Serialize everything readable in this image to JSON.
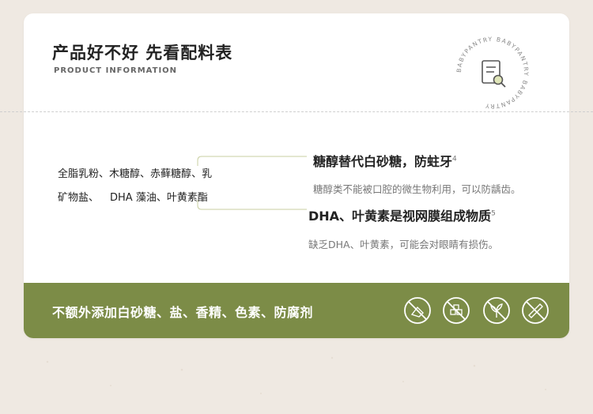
{
  "header": {
    "title": "产品好不好 先看配料表",
    "subtitle": "PRODUCT INFORMATION",
    "badge_text": "BABYPANTRY BABYPANTRY BABYPANTRY"
  },
  "ingredients": {
    "line1_part1": "全脂乳粉、",
    "line1_hl1": "木糖醇",
    "line1_sep": "、",
    "line1_hl2": "赤藓糖醇",
    "line1_part2": "、乳",
    "line2_part1": "矿物盐、",
    "line2_hl": "DHA 藻油、叶黄素酯"
  },
  "benefits": [
    {
      "title": "糖醇替代白砂糖，防蛀牙",
      "note": "4",
      "desc": "糖醇类不能被口腔的微生物利用，可以防龋齿。"
    },
    {
      "title": "DHA、叶黄素是视网膜组成物质",
      "note": "5",
      "desc": "缺乏DHA、叶黄素，可能会对眼睛有损伤。"
    }
  ],
  "footer": {
    "statement": "不额外添加白砂糖、盐、香精、色素、防腐剂",
    "icons": [
      "no-sugar-icon",
      "no-salt-icon",
      "no-flavor-icon",
      "no-preservative-icon"
    ]
  },
  "colors": {
    "band": "#7c8c47",
    "highlight": "#dfe5b8",
    "background": "#efe9e2"
  }
}
